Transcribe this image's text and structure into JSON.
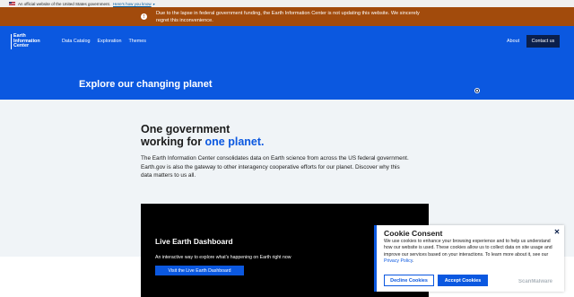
{
  "gov_banner": {
    "text": "An official website of the United States government",
    "link": "Here's how you know"
  },
  "alert": {
    "text": "Due to the lapse in federal government funding, the Earth Information Center is not updating this website. We sincerely regret this inconvenience."
  },
  "header": {
    "logo_lines": [
      "Earth",
      "Information",
      "Center"
    ],
    "nav": [
      "Data Catalog",
      "Exploration",
      "Themes"
    ],
    "about": "About",
    "contact": "Contact us",
    "hero_title": "Explore our changing planet"
  },
  "main": {
    "heading_line1": "One government",
    "heading_line2_prefix": "working for ",
    "heading_line2_accent": "one planet.",
    "intro": "The Earth Information Center consolidates data on Earth science from across the US federal government. Earth.gov is also the gateway to other interagency cooperative efforts for our planet. Discover why this data matters to us all."
  },
  "dashboard": {
    "title": "Live Earth Dashboard",
    "subtitle": "An interactive way to explore what's happening on Earth right now",
    "button": "Visit the Live Earth Dashboard"
  },
  "cookie": {
    "title": "Cookie Consent",
    "text": "We use cookies to enhance your browsing experience and to help us understand how our website is used. These cookies allow us to collect data on site usage and improve our services based on your interactions. To learn more about it, see our ",
    "policy_link": "Privacy Policy",
    "policy_end": ".",
    "decline": "Decline Cookies",
    "accept": "Accept Cookies"
  },
  "watermark": "ScanMalware",
  "colors": {
    "brand_blue": "#0b58e0",
    "navy": "#0b1f4b",
    "alert_orange": "#a24b0c"
  }
}
